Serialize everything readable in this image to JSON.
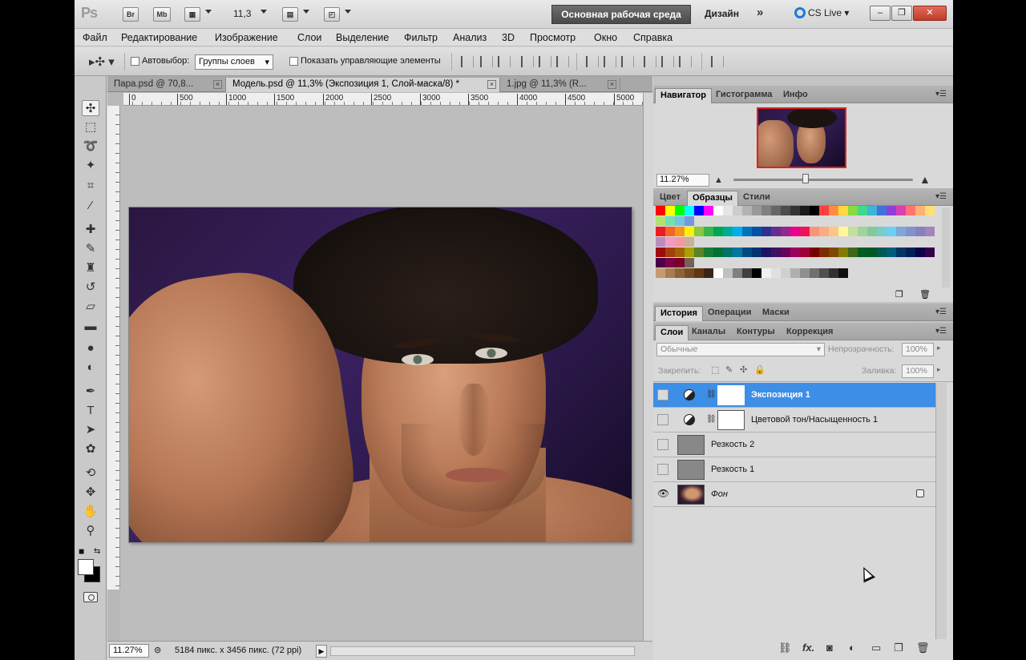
{
  "app": {
    "logo": "Ps",
    "bridge_icon": "Br",
    "minibridge_icon": "Mb",
    "zoom_value": "11,3",
    "workspace_label": "Основная рабочая среда",
    "design_label": "Дизайн",
    "more_label": "»",
    "cs_live_label": "CS Live",
    "minimize_label": "–",
    "maximize_label": "❐",
    "close_label": "✕"
  },
  "menu": [
    "Файл",
    "Редактирование",
    "Изображение",
    "Слои",
    "Выделение",
    "Фильтр",
    "Анализ",
    "3D",
    "Просмотр",
    "Окно",
    "Справка"
  ],
  "options": {
    "autoselect_label": "Автовыбор:",
    "autoselect_value": "Группы слоев",
    "show_controls_label": "Показать управляющие элементы"
  },
  "tabs": [
    {
      "label": "Пара.psd @ 70,8..."
    },
    {
      "label": "Модель.psd @ 11,3% (Экспозиция 1, Слой-маска/8) *"
    },
    {
      "label": "1.jpg @ 11,3% (R..."
    }
  ],
  "ruler_ticks": [
    "0",
    "500",
    "1000",
    "1500",
    "2000",
    "2500",
    "3000",
    "3500",
    "4000",
    "4500",
    "5000"
  ],
  "status": {
    "zoom": "11.27%",
    "info": "5184 пикс. x 3456 пикс. (72 ppi)"
  },
  "navigator": {
    "tabs": [
      "Навигатор",
      "Гистограмма",
      "Инфо"
    ],
    "zoom": "11.27%",
    "zoom_position": 0.4
  },
  "color_panel": {
    "tabs": [
      "Цвет",
      "Образцы",
      "Стили"
    ]
  },
  "history_panel": {
    "tabs": [
      "История",
      "Операции",
      "Маски"
    ]
  },
  "layers_panel": {
    "tabs": [
      "Слои",
      "Каналы",
      "Контуры",
      "Коррекция"
    ],
    "blend_mode": "Обычные",
    "opacity_label": "Непрозрачность:",
    "opacity_value": "100%",
    "lock_label": "Закрепить:",
    "fill_label": "Заливка:",
    "fill_value": "100%",
    "layers": [
      {
        "name": "Экспозиция 1",
        "kind": "adjustment",
        "selected": true,
        "visible": false
      },
      {
        "name": "Цветовой тон/Насыщенность 1",
        "kind": "adjustment",
        "selected": false,
        "visible": false
      },
      {
        "name": "Резкость 2",
        "kind": "pixel-gray",
        "selected": false,
        "visible": false
      },
      {
        "name": "Резкость 1",
        "kind": "pixel-gray",
        "selected": false,
        "visible": false
      },
      {
        "name": "Фон",
        "kind": "background",
        "selected": false,
        "visible": true,
        "locked": true
      }
    ]
  },
  "colors": {
    "accent": "#3d8ee6",
    "workspace_button": "#5a5a5a",
    "photo_background": "#2a1848"
  }
}
